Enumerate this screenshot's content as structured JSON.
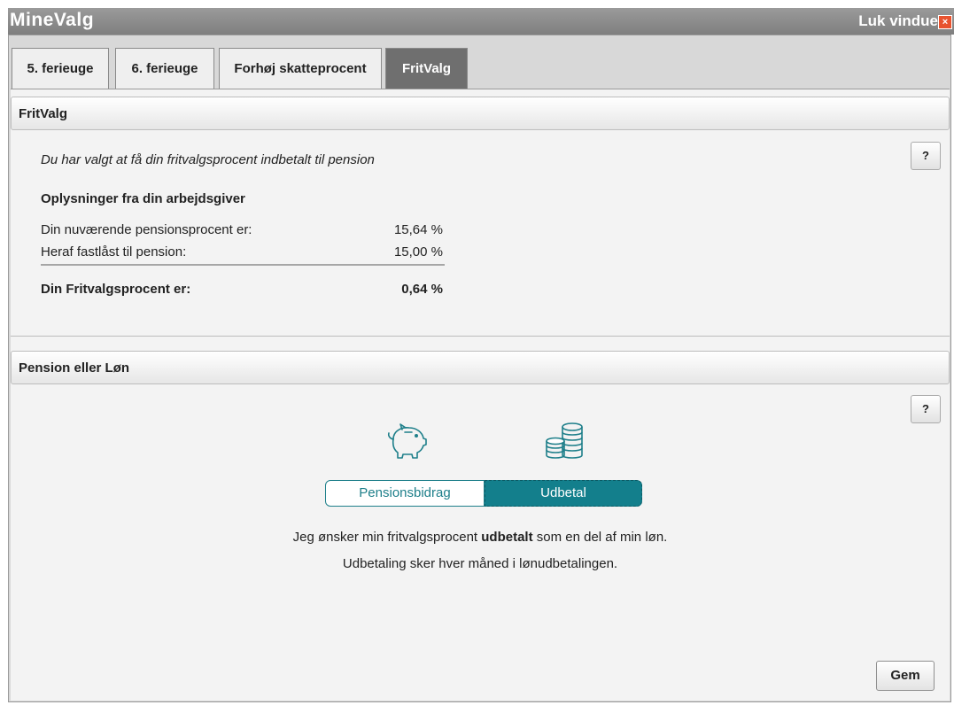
{
  "window": {
    "title": "MineValg",
    "close_label": "Luk vindue",
    "close_icon_char": "×"
  },
  "tabs": [
    {
      "label": "5. ferieuge",
      "active": false
    },
    {
      "label": "6. ferieuge",
      "active": false
    },
    {
      "label": "Forhøj skatteprocent",
      "active": false
    },
    {
      "label": "FritValg",
      "active": true
    }
  ],
  "fritvalg": {
    "header": "FritValg",
    "help_label": "?",
    "intro": "Du har valgt at få din fritvalgsprocent indbetalt til pension",
    "subheading": "Oplysninger fra din arbejdsgiver",
    "rows": [
      {
        "label": "Din nuværende pensionsprocent er:",
        "value": "15,64 %"
      },
      {
        "label": "Heraf fastlåst til pension:",
        "value": "15,00 %"
      }
    ],
    "total": {
      "label": "Din Fritvalgsprocent er:",
      "value": "0,64 %"
    }
  },
  "pension": {
    "header": "Pension eller Løn",
    "help_label": "?",
    "options": [
      "Pensionsbidrag",
      "Udbetal"
    ],
    "selected": "Udbetal",
    "message_pre": "Jeg ønsker min fritvalgsprocent ",
    "message_bold": "udbetalt",
    "message_post": " som en del af min løn.",
    "message_line2": "Udbetaling sker hver måned i lønudbetalingen.",
    "save_label": "Gem",
    "icons": [
      "piggy-bank-icon",
      "coins-icon"
    ],
    "accent_color": "#137f8c"
  }
}
